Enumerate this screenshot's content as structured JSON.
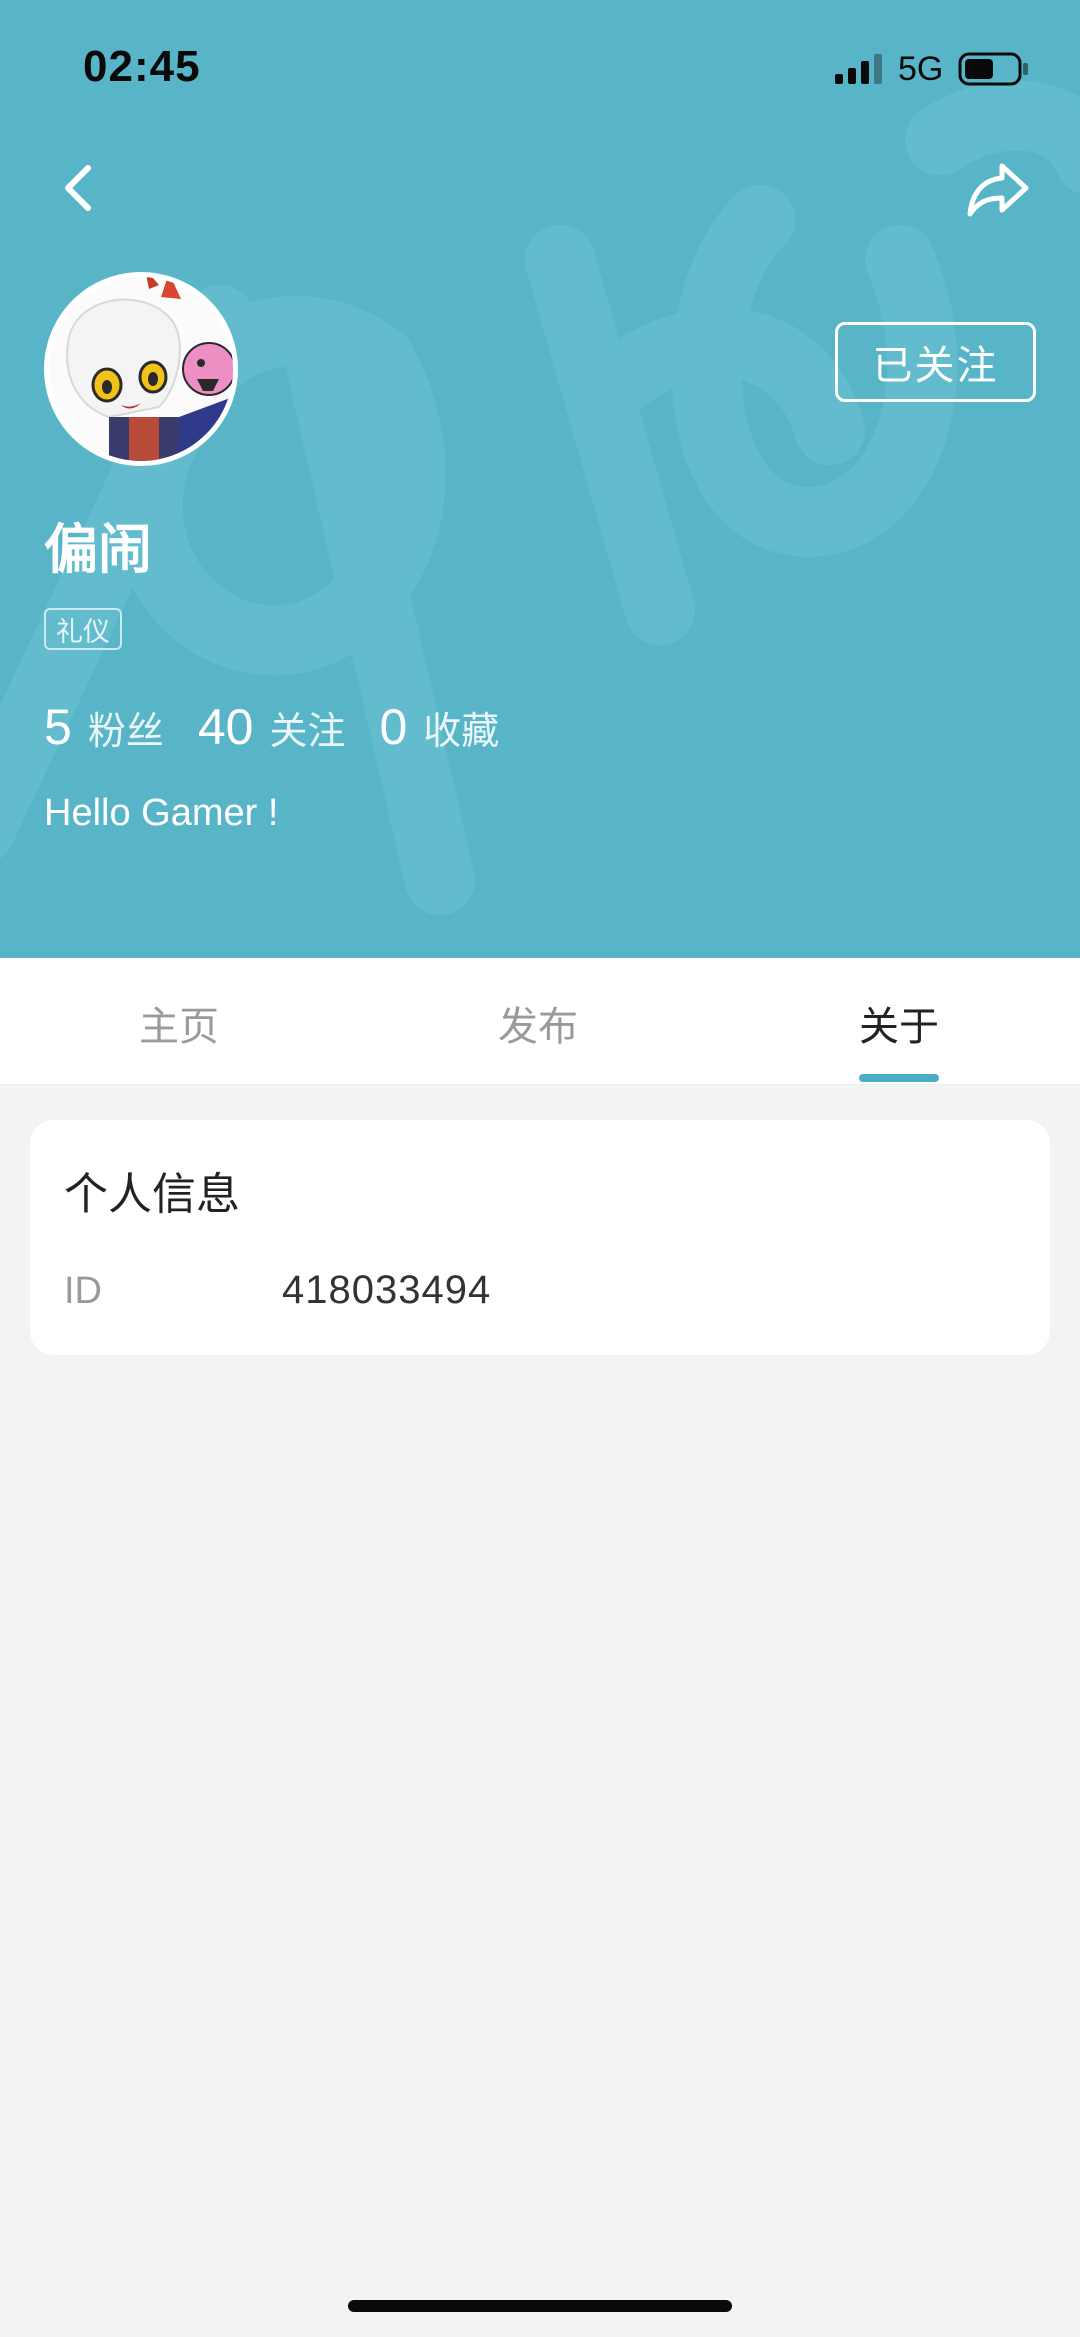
{
  "status_bar": {
    "time": "02:45",
    "network": "5G"
  },
  "profile": {
    "follow_label": "已关注",
    "username": "偏闹",
    "tag": "礼仪",
    "stats": [
      {
        "value": "5",
        "label": "粉丝"
      },
      {
        "value": "40",
        "label": "关注"
      },
      {
        "value": "0",
        "label": "收藏"
      }
    ],
    "bio": "Hello Gamer !"
  },
  "tabs": [
    {
      "label": "主页",
      "active": false
    },
    {
      "label": "发布",
      "active": false
    },
    {
      "label": "关于",
      "active": true
    }
  ],
  "info_card": {
    "title": "个人信息",
    "id_label": "ID",
    "id_value": "418033494"
  },
  "colors": {
    "header": "#58b5c7",
    "accent": "#4aaec3",
    "background": "#f3f3f3"
  },
  "icons": [
    "back-arrow-icon",
    "share-icon",
    "signal-icon",
    "battery-icon"
  ]
}
